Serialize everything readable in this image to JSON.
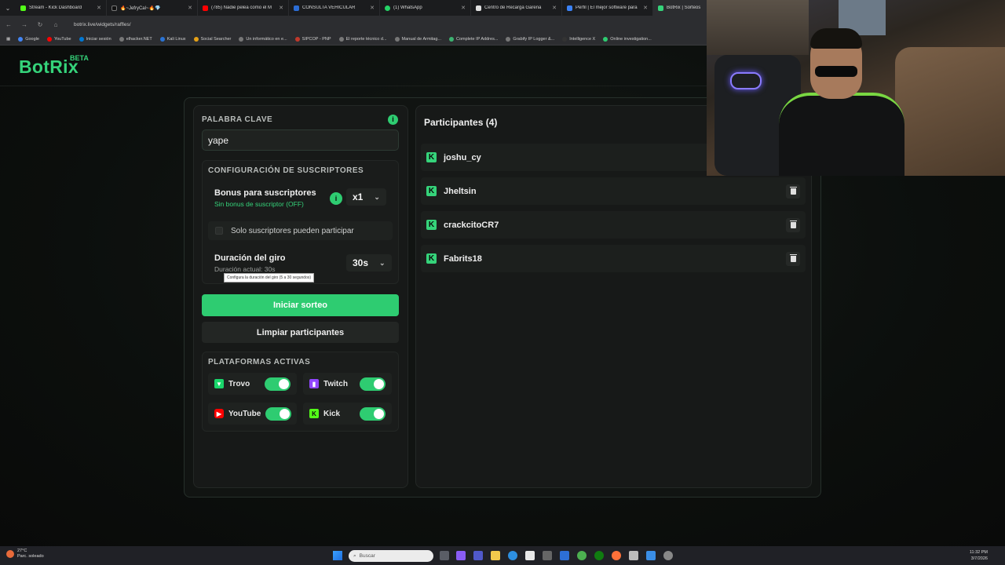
{
  "browser": {
    "tabs": [
      {
        "label": "Stream - Kick Dashboard",
        "color": "#53fc18"
      },
      {
        "label": "🔥~JefryCal~🔥💎",
        "color": "#111111"
      },
      {
        "label": "(785) Nadie pelea como el M",
        "color": "#ff0000"
      },
      {
        "label": "CONSULTA VEHICULAR",
        "color": "#2b6cd4"
      },
      {
        "label": "(1) WhatsApp",
        "color": "#25d366"
      },
      {
        "label": "Centro de Recarga Garena",
        "color": "#e0e0e0"
      },
      {
        "label": "Perfil | El mejor software para",
        "color": "#3b82f6"
      },
      {
        "label": "BotRix | Sorteos",
        "color": "#35d37a"
      }
    ],
    "url": "botrix.live/widgets/raffles/",
    "bookmarks": [
      "Google",
      "YouTube",
      "Iniciar sesión",
      "elhacker.NET",
      "Kali Linux",
      "Social Searcher",
      "Un informático en e...",
      "SIPCOP - PNP",
      "El reporte técnico d...",
      "Manual de Armitag...",
      "Complete IP Addres...",
      "Grabify IP Logger &...",
      "Intelligence X",
      "Online investigation..."
    ]
  },
  "site": {
    "logo": "BotRix",
    "beta": "BETA"
  },
  "keyword": {
    "label": "PALABRA CLAVE",
    "value": "yape",
    "info": "i"
  },
  "sub_config": {
    "title": "CONFIGURACIÓN DE SUSCRIPTORES",
    "bonus_title": "Bonus para suscriptores",
    "bonus_sub": "Sin bonus de suscriptor (OFF)",
    "bonus_value": "x1",
    "only_subs_label": "Solo suscriptores pueden participar",
    "duration_title": "Duración del giro",
    "duration_sub": "Duración actual: 30s",
    "duration_value": "30s",
    "tooltip": "Configura la duración del giro (5 a 30 segundos)"
  },
  "actions": {
    "start": "Iniciar sorteo",
    "clear": "Limpiar participantes"
  },
  "platforms": {
    "title": "PLATAFORMAS ACTIVAS",
    "items": [
      {
        "name": "Trovo",
        "enabled": true,
        "color": "#19d66b",
        "icon": "trovo-icon"
      },
      {
        "name": "Twitch",
        "enabled": true,
        "color": "#9146ff",
        "icon": "twitch-icon"
      },
      {
        "name": "YouTube",
        "enabled": true,
        "color": "#ff0000",
        "icon": "youtube-icon"
      },
      {
        "name": "Kick",
        "enabled": true,
        "color": "#53fc18",
        "icon": "kick-icon"
      }
    ]
  },
  "participants": {
    "title": "Participantes (4)",
    "list": [
      "joshu_cy",
      "Jheltsin",
      "crackcitoCR7",
      "Fabrits18"
    ]
  },
  "taskbar": {
    "temperature": "27°C",
    "weather": "Parc. soleado",
    "search_placeholder": "Buscar",
    "time": "11:32 PM",
    "date": "3/7/2026"
  },
  "colors": {
    "accent": "#2ecc71",
    "logo": "#35d37a",
    "background": "#0b0d0c"
  }
}
